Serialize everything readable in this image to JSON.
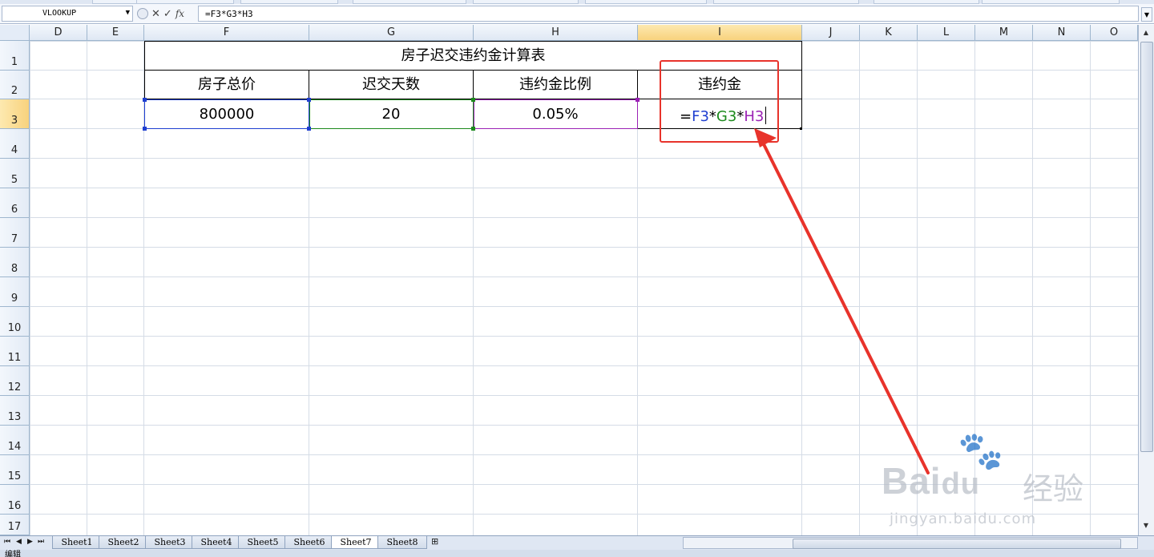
{
  "formula_bar": {
    "name_box": "VLOOKUP",
    "cancel_glyph": "✕",
    "enter_glyph": "✓",
    "fx_label": "fx",
    "formula": "=F3*G3*H3"
  },
  "columns": [
    "D",
    "E",
    "F",
    "G",
    "H",
    "I",
    "J",
    "K",
    "L",
    "M",
    "N",
    "O"
  ],
  "selected_column": "I",
  "rows": [
    "1",
    "2",
    "3",
    "4",
    "5",
    "6",
    "7",
    "8",
    "9",
    "10",
    "11",
    "12",
    "13",
    "14",
    "15",
    "16",
    "17"
  ],
  "selected_row": "3",
  "table": {
    "title": "房子迟交违约金计算表",
    "headers": [
      "房子总价",
      "迟交天数",
      "违约金比例",
      "违约金"
    ],
    "values": [
      "800000",
      "20",
      "0.05%"
    ]
  },
  "editing_cell": {
    "eq": "=",
    "ref1": "F3",
    "op1": "*",
    "ref2": "G3",
    "op2": "*",
    "ref3": "H3"
  },
  "ref_colors": {
    "F3": "#1f3fd0",
    "G3": "#1d8a1d",
    "H3": "#9b22b5"
  },
  "annotation_color": "#e8332b",
  "sheet_tabs": [
    "Sheet1",
    "Sheet2",
    "Sheet3",
    "Sheet4",
    "Sheet5",
    "Sheet6",
    "Sheet7",
    "Sheet8"
  ],
  "active_sheet": "Sheet7",
  "status_text": "编辑",
  "watermark": {
    "paw": "🐾",
    "brand": "Bai",
    "brand2": "du",
    "cn": "经验",
    "url": "jingyan.baidu.com"
  }
}
